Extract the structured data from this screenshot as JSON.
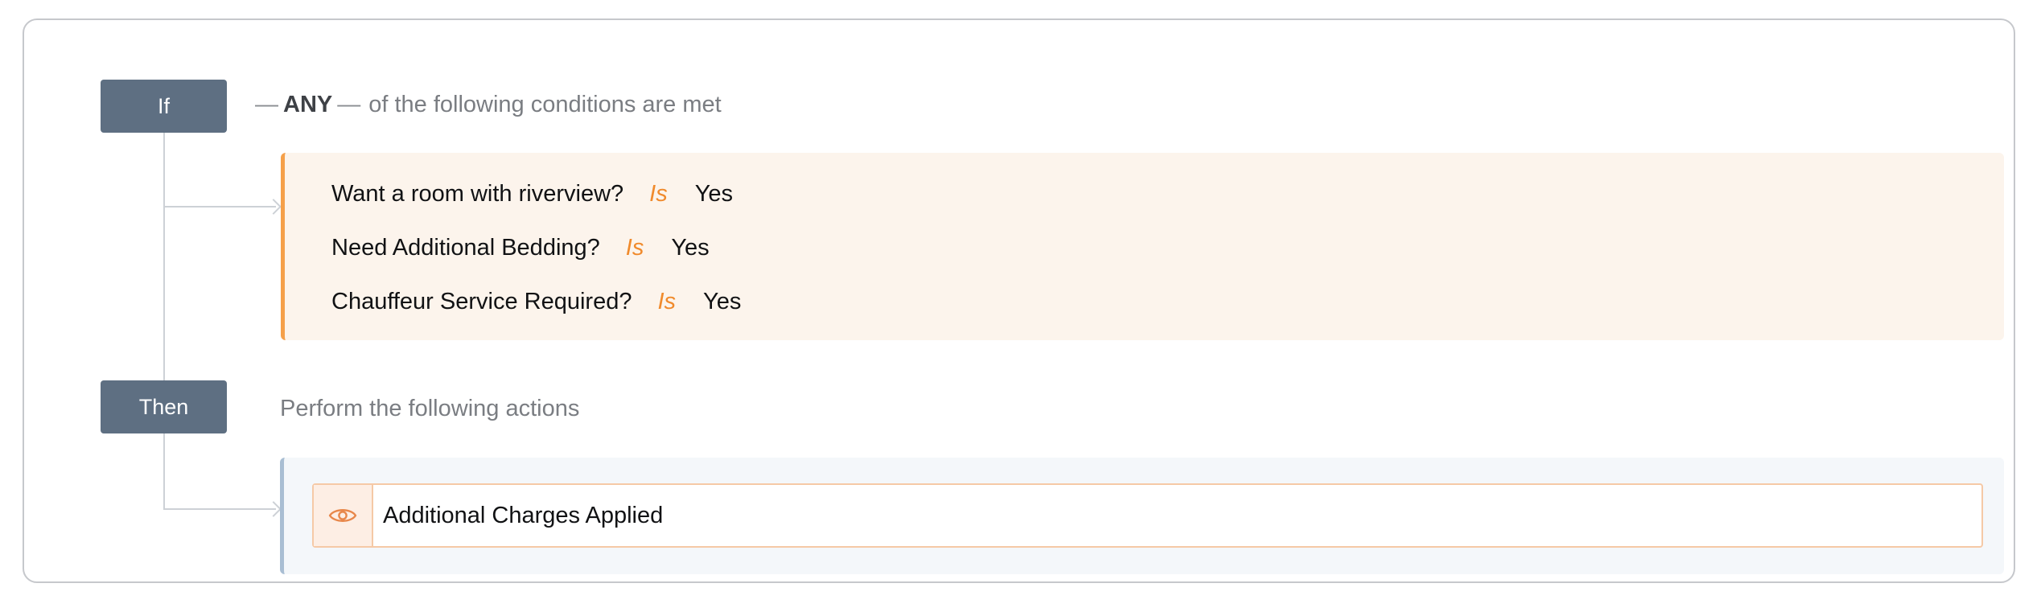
{
  "rule": {
    "if_label": "If",
    "then_label": "Then",
    "match_dash_left": "—",
    "match_mode": "ANY",
    "match_dash_right": "—",
    "match_text": "of the following conditions are met",
    "conditions": [
      {
        "field": "Want a room with riverview?",
        "operator": "Is",
        "value": "Yes"
      },
      {
        "field": "Need Additional Bedding?",
        "operator": "Is",
        "value": "Yes"
      },
      {
        "field": "Chauffeur Service Required?",
        "operator": "Is",
        "value": "Yes"
      }
    ],
    "then_text": "Perform the following actions",
    "actions": [
      {
        "icon": "eye-icon",
        "label": "Additional Charges Applied"
      }
    ]
  },
  "colors": {
    "tag_bg": "#5e6f82",
    "condition_accent": "#f5a04a",
    "operator": "#f08a2c",
    "action_accent": "#a9bed3"
  }
}
